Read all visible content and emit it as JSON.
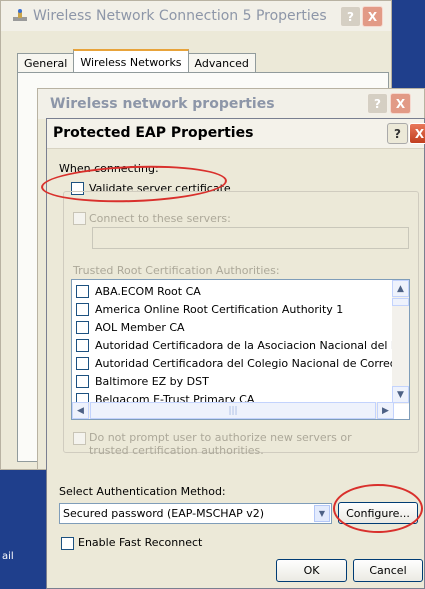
{
  "desktop": {
    "left_label": "ail"
  },
  "win1": {
    "title": "Wireless Network Connection 5 Properties",
    "tabs": [
      "General",
      "Wireless Networks",
      "Advanced"
    ]
  },
  "win2": {
    "title": "Wireless network properties"
  },
  "win3": {
    "title": "Protected EAP Properties",
    "when_connecting": "When connecting:",
    "validate_server_cert": "Validate server certificate",
    "connect_to_servers": "Connect to these servers:",
    "servers_value": "",
    "trusted_root_label": "Trusted Root Certification Authorities:",
    "trusted_roots": [
      "ABA.ECOM Root CA",
      "America Online Root Certification Authority 1",
      "AOL Member CA",
      "Autoridad Certificadora de la Asociacion Nacional del Notaria",
      "Autoridad Certificadora del Colegio Nacional de Correduria P",
      "Baltimore EZ by DST",
      "Belgacom E-Trust Primary CA"
    ],
    "do_not_prompt": "Do not prompt user to authorize new servers or trusted certification authorities.",
    "select_auth_label": "Select Authentication Method:",
    "auth_method_value": "Secured password (EAP-MSCHAP v2)",
    "configure_button": "Configure...",
    "enable_fast_reconnect": "Enable Fast Reconnect",
    "ok_button": "OK",
    "cancel_button": "Cancel"
  },
  "controls": {
    "help": "?",
    "close": "X"
  },
  "colors": {
    "annotation_red": "#d9302c",
    "xp_blue": "#003c74"
  }
}
